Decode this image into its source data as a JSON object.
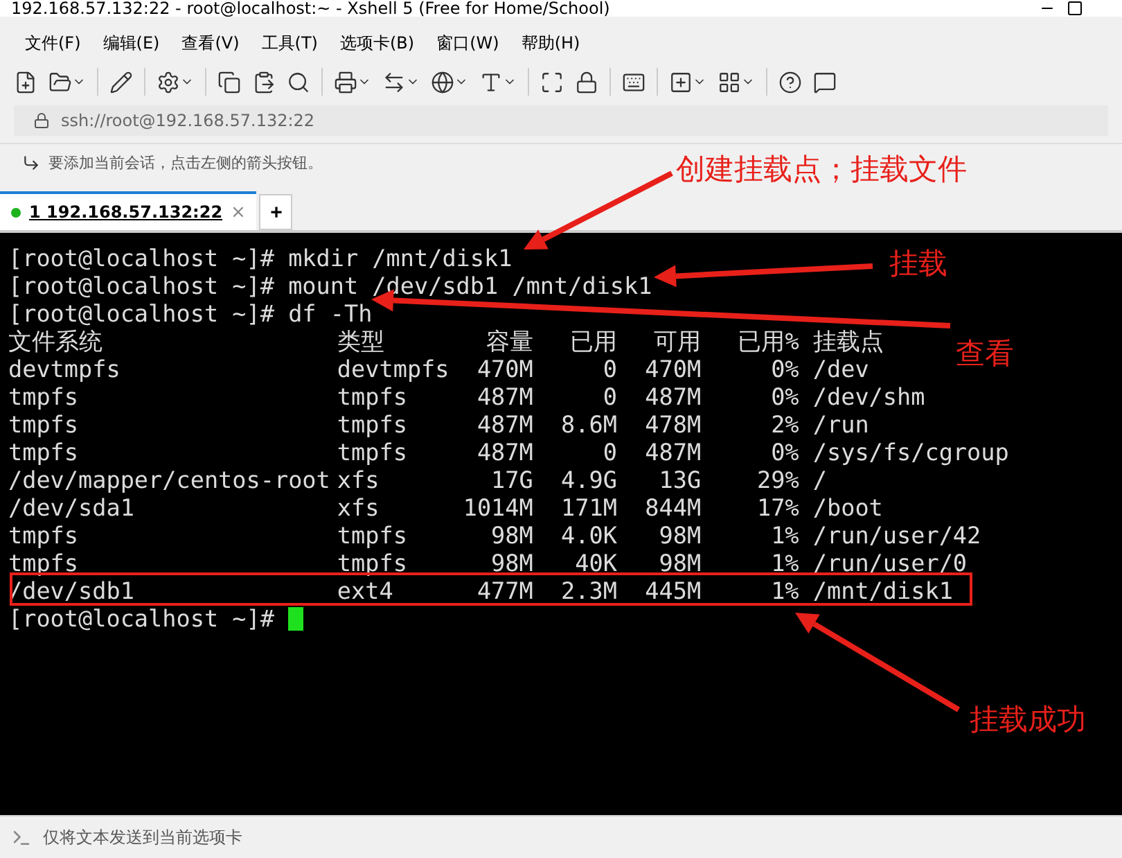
{
  "window": {
    "title": "192.168.57.132:22 - root@localhost:~ - Xshell 5 (Free for Home/School)"
  },
  "menu": [
    "文件(F)",
    "编辑(E)",
    "查看(V)",
    "工具(T)",
    "选项卡(B)",
    "窗口(W)",
    "帮助(H)"
  ],
  "address": "ssh://root@192.168.57.132:22",
  "hint": "要添加当前会话，点击左侧的箭头按钮。",
  "tabs": [
    {
      "label": "1 192.168.57.132:22",
      "close": "×",
      "selected": true,
      "connected": true
    }
  ],
  "new_tab": "+",
  "terminal": {
    "commands": [
      "[root@localhost ~]# mkdir /mnt/disk1",
      "[root@localhost ~]# mount /dev/sdb1 /mnt/disk1",
      "[root@localhost ~]# df -Th"
    ],
    "df_columns": [
      "文件系统",
      "类型",
      "容量",
      "已用",
      "可用",
      "已用%",
      "挂载点"
    ],
    "df_rows": [
      [
        "devtmpfs",
        "devtmpfs",
        "470M",
        "0",
        "470M",
        "0%",
        "/dev"
      ],
      [
        "tmpfs",
        "tmpfs",
        "487M",
        "0",
        "487M",
        "0%",
        "/dev/shm"
      ],
      [
        "tmpfs",
        "tmpfs",
        "487M",
        "8.6M",
        "478M",
        "2%",
        "/run"
      ],
      [
        "tmpfs",
        "tmpfs",
        "487M",
        "0",
        "487M",
        "0%",
        "/sys/fs/cgroup"
      ],
      [
        "/dev/mapper/centos-root",
        "xfs",
        "17G",
        "4.9G",
        "13G",
        "29%",
        "/"
      ],
      [
        "/dev/sda1",
        "xfs",
        "1014M",
        "171M",
        "844M",
        "17%",
        "/boot"
      ],
      [
        "tmpfs",
        "tmpfs",
        "98M",
        "4.0K",
        "98M",
        "1%",
        "/run/user/42"
      ],
      [
        "tmpfs",
        "tmpfs",
        "98M",
        "40K",
        "98M",
        "1%",
        "/run/user/0"
      ],
      [
        "/dev/sdb1",
        "ext4",
        "477M",
        "2.3M",
        "445M",
        "1%",
        "/mnt/disk1"
      ]
    ],
    "prompt": "[root@localhost ~]#"
  },
  "annotations": [
    "创建挂载点；挂载文件",
    "挂载",
    "查看",
    "挂载成功"
  ],
  "status_bar": {
    "text": "仅将文本发送到当前选项卡"
  }
}
